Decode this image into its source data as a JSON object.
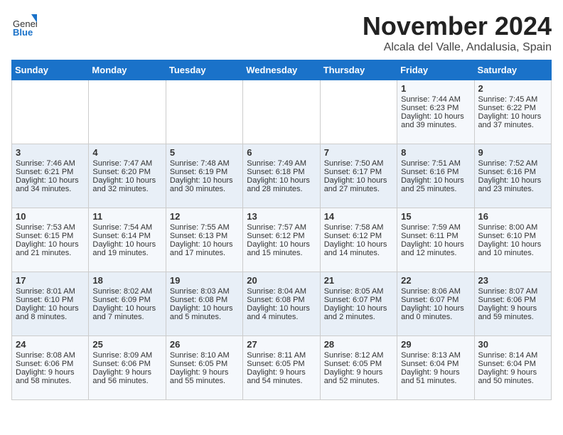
{
  "header": {
    "logo_general": "General",
    "logo_blue": "Blue",
    "month_title": "November 2024",
    "location": "Alcala del Valle, Andalusia, Spain"
  },
  "days_of_week": [
    "Sunday",
    "Monday",
    "Tuesday",
    "Wednesday",
    "Thursday",
    "Friday",
    "Saturday"
  ],
  "weeks": [
    [
      {
        "day": "",
        "content": ""
      },
      {
        "day": "",
        "content": ""
      },
      {
        "day": "",
        "content": ""
      },
      {
        "day": "",
        "content": ""
      },
      {
        "day": "",
        "content": ""
      },
      {
        "day": "1",
        "content": "Sunrise: 7:44 AM\nSunset: 6:23 PM\nDaylight: 10 hours and 39 minutes."
      },
      {
        "day": "2",
        "content": "Sunrise: 7:45 AM\nSunset: 6:22 PM\nDaylight: 10 hours and 37 minutes."
      }
    ],
    [
      {
        "day": "3",
        "content": "Sunrise: 7:46 AM\nSunset: 6:21 PM\nDaylight: 10 hours and 34 minutes."
      },
      {
        "day": "4",
        "content": "Sunrise: 7:47 AM\nSunset: 6:20 PM\nDaylight: 10 hours and 32 minutes."
      },
      {
        "day": "5",
        "content": "Sunrise: 7:48 AM\nSunset: 6:19 PM\nDaylight: 10 hours and 30 minutes."
      },
      {
        "day": "6",
        "content": "Sunrise: 7:49 AM\nSunset: 6:18 PM\nDaylight: 10 hours and 28 minutes."
      },
      {
        "day": "7",
        "content": "Sunrise: 7:50 AM\nSunset: 6:17 PM\nDaylight: 10 hours and 27 minutes."
      },
      {
        "day": "8",
        "content": "Sunrise: 7:51 AM\nSunset: 6:16 PM\nDaylight: 10 hours and 25 minutes."
      },
      {
        "day": "9",
        "content": "Sunrise: 7:52 AM\nSunset: 6:16 PM\nDaylight: 10 hours and 23 minutes."
      }
    ],
    [
      {
        "day": "10",
        "content": "Sunrise: 7:53 AM\nSunset: 6:15 PM\nDaylight: 10 hours and 21 minutes."
      },
      {
        "day": "11",
        "content": "Sunrise: 7:54 AM\nSunset: 6:14 PM\nDaylight: 10 hours and 19 minutes."
      },
      {
        "day": "12",
        "content": "Sunrise: 7:55 AM\nSunset: 6:13 PM\nDaylight: 10 hours and 17 minutes."
      },
      {
        "day": "13",
        "content": "Sunrise: 7:57 AM\nSunset: 6:12 PM\nDaylight: 10 hours and 15 minutes."
      },
      {
        "day": "14",
        "content": "Sunrise: 7:58 AM\nSunset: 6:12 PM\nDaylight: 10 hours and 14 minutes."
      },
      {
        "day": "15",
        "content": "Sunrise: 7:59 AM\nSunset: 6:11 PM\nDaylight: 10 hours and 12 minutes."
      },
      {
        "day": "16",
        "content": "Sunrise: 8:00 AM\nSunset: 6:10 PM\nDaylight: 10 hours and 10 minutes."
      }
    ],
    [
      {
        "day": "17",
        "content": "Sunrise: 8:01 AM\nSunset: 6:10 PM\nDaylight: 10 hours and 8 minutes."
      },
      {
        "day": "18",
        "content": "Sunrise: 8:02 AM\nSunset: 6:09 PM\nDaylight: 10 hours and 7 minutes."
      },
      {
        "day": "19",
        "content": "Sunrise: 8:03 AM\nSunset: 6:08 PM\nDaylight: 10 hours and 5 minutes."
      },
      {
        "day": "20",
        "content": "Sunrise: 8:04 AM\nSunset: 6:08 PM\nDaylight: 10 hours and 4 minutes."
      },
      {
        "day": "21",
        "content": "Sunrise: 8:05 AM\nSunset: 6:07 PM\nDaylight: 10 hours and 2 minutes."
      },
      {
        "day": "22",
        "content": "Sunrise: 8:06 AM\nSunset: 6:07 PM\nDaylight: 10 hours and 0 minutes."
      },
      {
        "day": "23",
        "content": "Sunrise: 8:07 AM\nSunset: 6:06 PM\nDaylight: 9 hours and 59 minutes."
      }
    ],
    [
      {
        "day": "24",
        "content": "Sunrise: 8:08 AM\nSunset: 6:06 PM\nDaylight: 9 hours and 58 minutes."
      },
      {
        "day": "25",
        "content": "Sunrise: 8:09 AM\nSunset: 6:06 PM\nDaylight: 9 hours and 56 minutes."
      },
      {
        "day": "26",
        "content": "Sunrise: 8:10 AM\nSunset: 6:05 PM\nDaylight: 9 hours and 55 minutes."
      },
      {
        "day": "27",
        "content": "Sunrise: 8:11 AM\nSunset: 6:05 PM\nDaylight: 9 hours and 54 minutes."
      },
      {
        "day": "28",
        "content": "Sunrise: 8:12 AM\nSunset: 6:05 PM\nDaylight: 9 hours and 52 minutes."
      },
      {
        "day": "29",
        "content": "Sunrise: 8:13 AM\nSunset: 6:04 PM\nDaylight: 9 hours and 51 minutes."
      },
      {
        "day": "30",
        "content": "Sunrise: 8:14 AM\nSunset: 6:04 PM\nDaylight: 9 hours and 50 minutes."
      }
    ]
  ]
}
